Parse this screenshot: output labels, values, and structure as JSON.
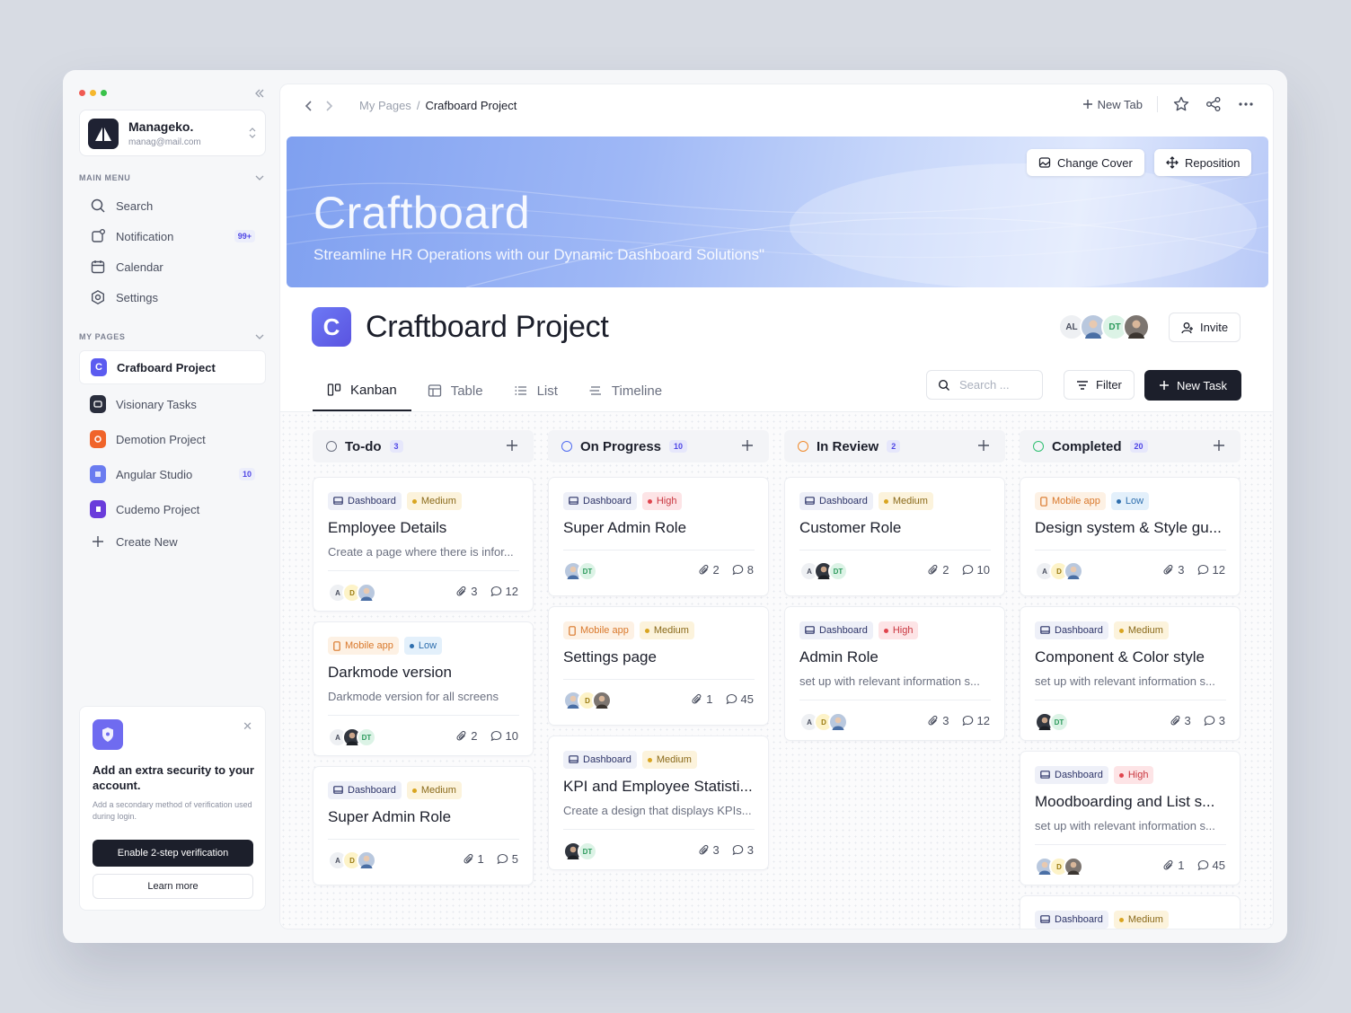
{
  "colors": {
    "accent": "#4f46e5",
    "dark": "#1c1f2b",
    "todo": "#6b7080",
    "progress": "#4f6bf0",
    "review": "#f08a2c",
    "completed": "#2fbf71"
  },
  "sidebar": {
    "account": {
      "name": "Manageko.",
      "email": "manag@mail.com"
    },
    "main_menu_label": "MAIN MENU",
    "main_menu": [
      {
        "label": "Search",
        "icon": "search-icon"
      },
      {
        "label": "Notification",
        "icon": "bell-icon",
        "badge": "99+"
      },
      {
        "label": "Calendar",
        "icon": "calendar-icon"
      },
      {
        "label": "Settings",
        "icon": "gear-icon"
      }
    ],
    "my_pages_label": "MY PAGES",
    "pages": [
      {
        "label": "Crafboard Project",
        "color": "#5b5bf0",
        "active": true
      },
      {
        "label": "Visionary Tasks",
        "color": "#2a2e3d"
      },
      {
        "label": "Demotion Project",
        "color": "#f0642a"
      },
      {
        "label": "Angular Studio",
        "color": "#6a7cf0",
        "badge": "10"
      },
      {
        "label": "Cudemo Project",
        "color": "#6a3cdb"
      }
    ],
    "create_new": "Create New",
    "promo": {
      "title": "Add an extra security to your account.",
      "description": "Add a secondary method of verification used during login.",
      "primary_button": "Enable 2-step verification",
      "secondary_button": "Learn more"
    }
  },
  "topbar": {
    "breadcrumb": [
      "My Pages",
      "Crafboard Project"
    ],
    "breadcrumb_separator": "/",
    "new_tab": "New Tab"
  },
  "cover": {
    "title": "Craftboard",
    "subtitle": "Streamline HR Operations with our Dynamic Dashboard Solutions\"",
    "change_cover": "Change Cover",
    "reposition": "Reposition"
  },
  "project": {
    "logo_letter": "C",
    "title": "Craftboard Project",
    "members": [
      "AL",
      "",
      "DT",
      ""
    ],
    "invite": "Invite"
  },
  "views": {
    "tabs": [
      "Kanban",
      "Table",
      "List",
      "Timeline"
    ],
    "active": "Kanban",
    "search_placeholder": "Search ...",
    "filter": "Filter",
    "new_task": "New Task"
  },
  "board": {
    "columns": [
      {
        "name": "To-do",
        "count": "3",
        "status": "todo",
        "cards": [
          {
            "tags": [
              "Dashboard",
              "Medium"
            ],
            "title": "Employee Details",
            "desc": "Create a page where there is infor...",
            "avatars": [
              "A",
              "D",
              "p1"
            ],
            "attachments": "3",
            "comments": "12"
          },
          {
            "tags": [
              "Mobile app",
              "Low"
            ],
            "title": "Darkmode version",
            "desc": "Darkmode version for all screens",
            "avatars": [
              "A",
              "p2",
              "DT"
            ],
            "attachments": "2",
            "comments": "10"
          },
          {
            "tags": [
              "Dashboard",
              "Medium"
            ],
            "title": "Super Admin Role",
            "desc": "",
            "avatars": [
              "A",
              "D",
              "p1"
            ],
            "attachments": "1",
            "comments": "5"
          }
        ]
      },
      {
        "name": "On Progress",
        "count": "10",
        "status": "progress",
        "cards": [
          {
            "tags": [
              "Dashboard",
              "High"
            ],
            "title": "Super Admin Role",
            "desc": "",
            "avatars": [
              "p1",
              "DT"
            ],
            "attachments": "2",
            "comments": "8"
          },
          {
            "tags": [
              "Mobile app",
              "Medium"
            ],
            "title": "Settings page",
            "desc": "",
            "avatars": [
              "p1",
              "D",
              "p3"
            ],
            "attachments": "1",
            "comments": "45"
          },
          {
            "tags": [
              "Dashboard",
              "Medium"
            ],
            "title": "KPI and Employee Statisti...",
            "desc": "Create a design that displays KPIs...",
            "avatars": [
              "p2",
              "DT"
            ],
            "attachments": "3",
            "comments": "3"
          }
        ]
      },
      {
        "name": "In Review",
        "count": "2",
        "status": "review",
        "cards": [
          {
            "tags": [
              "Dashboard",
              "Medium"
            ],
            "title": "Customer Role",
            "desc": "",
            "avatars": [
              "A",
              "p2",
              "DT"
            ],
            "attachments": "2",
            "comments": "10"
          },
          {
            "tags": [
              "Dashboard",
              "High"
            ],
            "title": "Admin Role",
            "desc": "set up with relevant information s...",
            "avatars": [
              "A",
              "D",
              "p1"
            ],
            "attachments": "3",
            "comments": "12"
          }
        ]
      },
      {
        "name": "Completed",
        "count": "20",
        "status": "completed",
        "cards": [
          {
            "tags": [
              "Mobile app",
              "Low"
            ],
            "title": "Design system & Style gu...",
            "desc": "",
            "avatars": [
              "A",
              "D",
              "p1"
            ],
            "attachments": "3",
            "comments": "12"
          },
          {
            "tags": [
              "Dashboard",
              "Medium"
            ],
            "title": "Component & Color style",
            "desc": "set up with relevant information s...",
            "avatars": [
              "p2",
              "DT"
            ],
            "attachments": "3",
            "comments": "3"
          },
          {
            "tags": [
              "Dashboard",
              "High"
            ],
            "title": "Moodboarding and List s...",
            "desc": "set up with relevant information s...",
            "avatars": [
              "p1",
              "D",
              "p3"
            ],
            "attachments": "1",
            "comments": "45"
          },
          {
            "tags": [
              "Dashboard",
              "Medium"
            ],
            "title": "",
            "desc": "",
            "avatars": [],
            "attachments": "",
            "comments": ""
          }
        ]
      }
    ]
  }
}
